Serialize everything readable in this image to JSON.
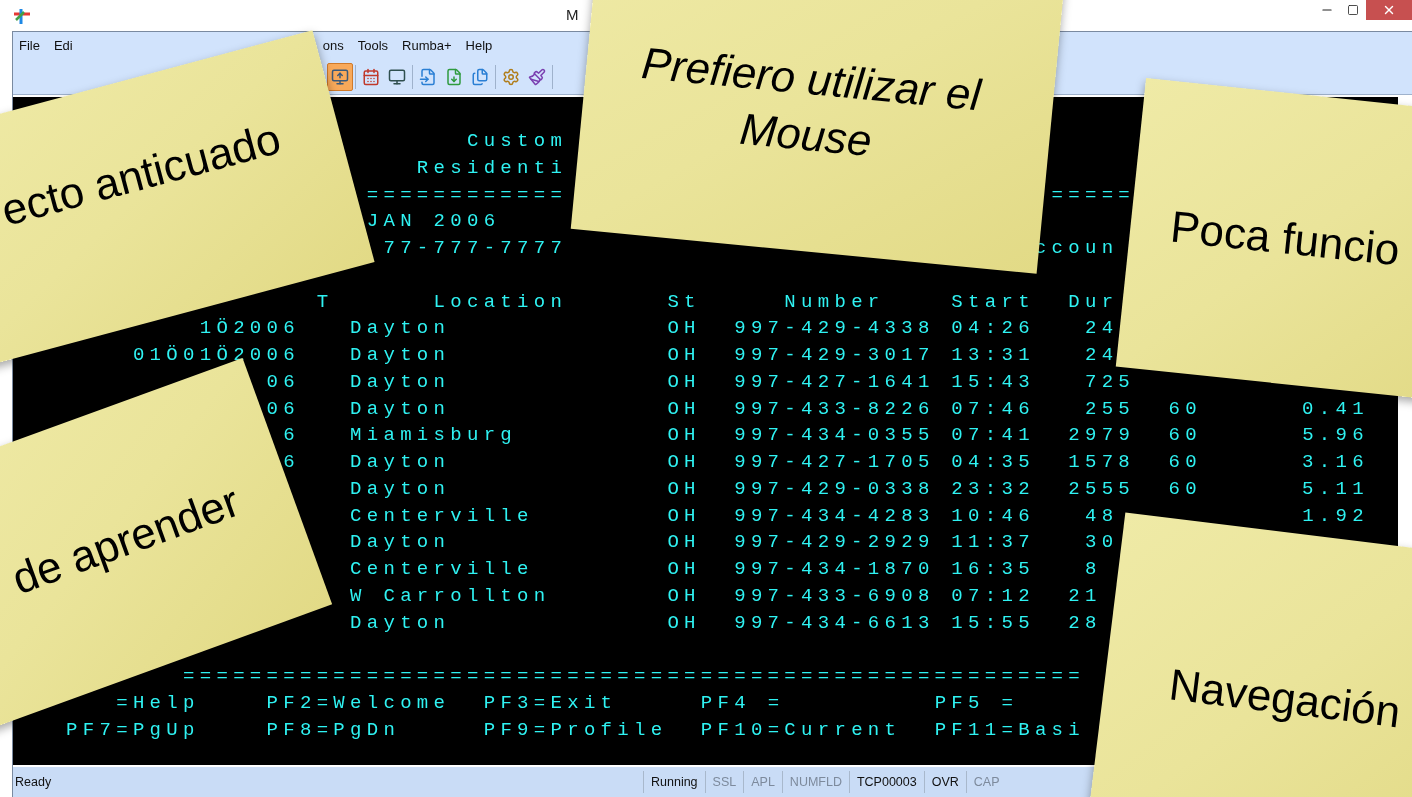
{
  "window": {
    "title": "M"
  },
  "menu": [
    "File",
    "Edi",
    "ons",
    "Tools",
    "Rumba+",
    "Help"
  ],
  "toolbar": [
    {
      "kind": "screen-arrow",
      "pressed": true
    },
    {
      "kind": "calendar",
      "pressed": false
    },
    {
      "kind": "monitor",
      "pressed": false
    },
    {
      "kind": "file-arrow",
      "pressed": false
    },
    {
      "kind": "file-down",
      "pressed": false
    },
    {
      "kind": "files",
      "pressed": false
    },
    {
      "kind": "gear",
      "pressed": false
    },
    {
      "kind": "brush",
      "pressed": false
    }
  ],
  "terminal": {
    "header_lines": [
      [
        "                           Custom"
      ],
      [
        "                        Residenti"
      ],
      [
        "                     ============",
        "                             ====="
      ],
      [
        "                     JAN 2006"
      ],
      [
        "                      77-777-7777",
        "                            ccoun"
      ]
    ],
    "table_lines": [
      [
        "                  T",
        "      Location",
        "      St",
        "     Number",
        "    Start",
        "  Dur"
      ],
      [
        "           1Ö2006",
        "   Dayton",
        "             OH",
        "  997-429-4338",
        " 04:26",
        "   24"
      ],
      [
        "       01Ö01Ö2006",
        "   Dayton",
        "             OH",
        "  997-429-3017",
        " 13:31",
        "   24"
      ],
      [
        "               06",
        "   Dayton",
        "             OH",
        "  997-427-1641",
        " 15:43",
        "   725"
      ],
      [
        "               06",
        "   Dayton",
        "             OH",
        "  997-433-8226",
        " 07:46",
        "   255",
        "  60",
        "      0.41"
      ],
      [
        "                6",
        "   Miamisburg",
        "         OH",
        "  997-434-0355",
        " 07:41",
        "  2979",
        "  60",
        "      5.96"
      ],
      [
        "                6",
        "   Dayton",
        "             OH",
        "  997-427-1705",
        " 04:35",
        "  1578",
        "  60",
        "      3.16"
      ],
      [
        "                    Dayton",
        "             OH",
        "  997-429-0338",
        " 23:32",
        "  2555",
        "  60",
        "      5.11"
      ],
      [
        "                    Centerville",
        "        OH",
        "  997-434-4283",
        " 10:46",
        "   48",
        "           1.92"
      ],
      [
        "                    Dayton",
        "             OH",
        "  997-429-2929",
        " 11:37",
        "   30"
      ],
      [
        "                    Centerville",
        "        OH",
        "  997-434-1870",
        " 16:35",
        "   8"
      ],
      [
        "                    W Carrollton",
        "       OH",
        "  997-433-6908",
        " 07:12",
        "  21"
      ],
      [
        "                    Dayton",
        "             OH",
        "  997-434-6613",
        " 15:55",
        "  28"
      ]
    ],
    "footer_lines": [
      [
        "          ======================================================"
      ],
      [
        "      =Help",
        "    PF2=Welcome",
        "  PF3=Exit",
        "     PF4 =",
        "         PF5 ="
      ],
      [
        "   PF7=PgUp",
        "    PF8=PgDn",
        "     PF9=Profile",
        "  PF10=Current",
        "  PF11=Basi"
      ]
    ]
  },
  "status_bar": {
    "message": "Ready",
    "cells": [
      {
        "text": "Running",
        "disabled": false
      },
      {
        "text": "SSL",
        "disabled": true
      },
      {
        "text": "APL",
        "disabled": true
      },
      {
        "text": "NUMFLD",
        "disabled": true
      },
      {
        "text": "TCP00003",
        "disabled": false
      },
      {
        "text": "OVR",
        "disabled": false
      },
      {
        "text": "CAP",
        "disabled": true
      }
    ]
  },
  "sticky_notes": [
    {
      "text": "ecto anticuado",
      "italic": false
    },
    {
      "text": "Prefiero utilizar el Mouse",
      "italic": true
    },
    {
      "text": "Poca funcio",
      "italic": false
    },
    {
      "text": "de aprender",
      "italic": false
    },
    {
      "text": "Navegación",
      "italic": false
    }
  ]
}
